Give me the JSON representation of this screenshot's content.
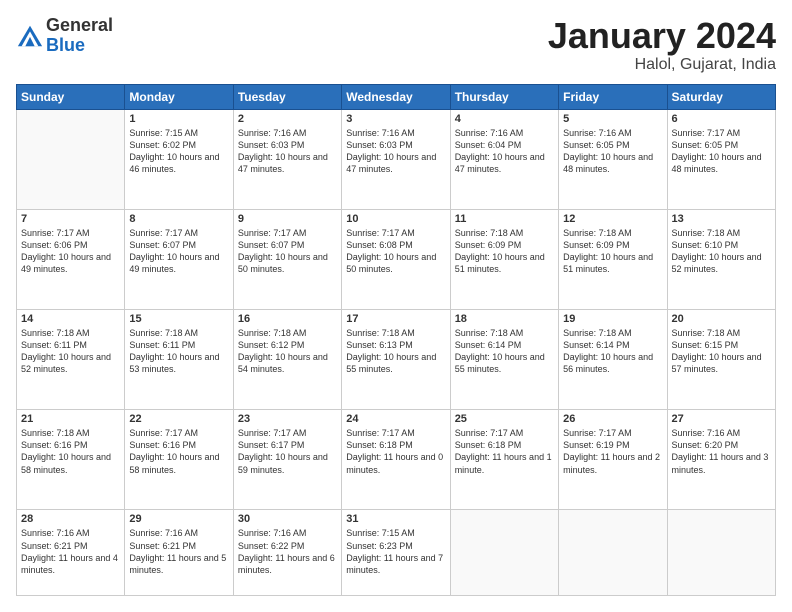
{
  "header": {
    "logo_general": "General",
    "logo_blue": "Blue",
    "month_title": "January 2024",
    "location": "Halol, Gujarat, India"
  },
  "days_of_week": [
    "Sunday",
    "Monday",
    "Tuesday",
    "Wednesday",
    "Thursday",
    "Friday",
    "Saturday"
  ],
  "weeks": [
    [
      {
        "day": "",
        "info": ""
      },
      {
        "day": "1",
        "info": "Sunrise: 7:15 AM\nSunset: 6:02 PM\nDaylight: 10 hours\nand 46 minutes."
      },
      {
        "day": "2",
        "info": "Sunrise: 7:16 AM\nSunset: 6:03 PM\nDaylight: 10 hours\nand 47 minutes."
      },
      {
        "day": "3",
        "info": "Sunrise: 7:16 AM\nSunset: 6:03 PM\nDaylight: 10 hours\nand 47 minutes."
      },
      {
        "day": "4",
        "info": "Sunrise: 7:16 AM\nSunset: 6:04 PM\nDaylight: 10 hours\nand 47 minutes."
      },
      {
        "day": "5",
        "info": "Sunrise: 7:16 AM\nSunset: 6:05 PM\nDaylight: 10 hours\nand 48 minutes."
      },
      {
        "day": "6",
        "info": "Sunrise: 7:17 AM\nSunset: 6:05 PM\nDaylight: 10 hours\nand 48 minutes."
      }
    ],
    [
      {
        "day": "7",
        "info": "Sunrise: 7:17 AM\nSunset: 6:06 PM\nDaylight: 10 hours\nand 49 minutes."
      },
      {
        "day": "8",
        "info": "Sunrise: 7:17 AM\nSunset: 6:07 PM\nDaylight: 10 hours\nand 49 minutes."
      },
      {
        "day": "9",
        "info": "Sunrise: 7:17 AM\nSunset: 6:07 PM\nDaylight: 10 hours\nand 50 minutes."
      },
      {
        "day": "10",
        "info": "Sunrise: 7:17 AM\nSunset: 6:08 PM\nDaylight: 10 hours\nand 50 minutes."
      },
      {
        "day": "11",
        "info": "Sunrise: 7:18 AM\nSunset: 6:09 PM\nDaylight: 10 hours\nand 51 minutes."
      },
      {
        "day": "12",
        "info": "Sunrise: 7:18 AM\nSunset: 6:09 PM\nDaylight: 10 hours\nand 51 minutes."
      },
      {
        "day": "13",
        "info": "Sunrise: 7:18 AM\nSunset: 6:10 PM\nDaylight: 10 hours\nand 52 minutes."
      }
    ],
    [
      {
        "day": "14",
        "info": "Sunrise: 7:18 AM\nSunset: 6:11 PM\nDaylight: 10 hours\nand 52 minutes."
      },
      {
        "day": "15",
        "info": "Sunrise: 7:18 AM\nSunset: 6:11 PM\nDaylight: 10 hours\nand 53 minutes."
      },
      {
        "day": "16",
        "info": "Sunrise: 7:18 AM\nSunset: 6:12 PM\nDaylight: 10 hours\nand 54 minutes."
      },
      {
        "day": "17",
        "info": "Sunrise: 7:18 AM\nSunset: 6:13 PM\nDaylight: 10 hours\nand 55 minutes."
      },
      {
        "day": "18",
        "info": "Sunrise: 7:18 AM\nSunset: 6:14 PM\nDaylight: 10 hours\nand 55 minutes."
      },
      {
        "day": "19",
        "info": "Sunrise: 7:18 AM\nSunset: 6:14 PM\nDaylight: 10 hours\nand 56 minutes."
      },
      {
        "day": "20",
        "info": "Sunrise: 7:18 AM\nSunset: 6:15 PM\nDaylight: 10 hours\nand 57 minutes."
      }
    ],
    [
      {
        "day": "21",
        "info": "Sunrise: 7:18 AM\nSunset: 6:16 PM\nDaylight: 10 hours\nand 58 minutes."
      },
      {
        "day": "22",
        "info": "Sunrise: 7:17 AM\nSunset: 6:16 PM\nDaylight: 10 hours\nand 58 minutes."
      },
      {
        "day": "23",
        "info": "Sunrise: 7:17 AM\nSunset: 6:17 PM\nDaylight: 10 hours\nand 59 minutes."
      },
      {
        "day": "24",
        "info": "Sunrise: 7:17 AM\nSunset: 6:18 PM\nDaylight: 11 hours\nand 0 minutes."
      },
      {
        "day": "25",
        "info": "Sunrise: 7:17 AM\nSunset: 6:18 PM\nDaylight: 11 hours\nand 1 minute."
      },
      {
        "day": "26",
        "info": "Sunrise: 7:17 AM\nSunset: 6:19 PM\nDaylight: 11 hours\nand 2 minutes."
      },
      {
        "day": "27",
        "info": "Sunrise: 7:16 AM\nSunset: 6:20 PM\nDaylight: 11 hours\nand 3 minutes."
      }
    ],
    [
      {
        "day": "28",
        "info": "Sunrise: 7:16 AM\nSunset: 6:21 PM\nDaylight: 11 hours\nand 4 minutes."
      },
      {
        "day": "29",
        "info": "Sunrise: 7:16 AM\nSunset: 6:21 PM\nDaylight: 11 hours\nand 5 minutes."
      },
      {
        "day": "30",
        "info": "Sunrise: 7:16 AM\nSunset: 6:22 PM\nDaylight: 11 hours\nand 6 minutes."
      },
      {
        "day": "31",
        "info": "Sunrise: 7:15 AM\nSunset: 6:23 PM\nDaylight: 11 hours\nand 7 minutes."
      },
      {
        "day": "",
        "info": ""
      },
      {
        "day": "",
        "info": ""
      },
      {
        "day": "",
        "info": ""
      }
    ]
  ]
}
